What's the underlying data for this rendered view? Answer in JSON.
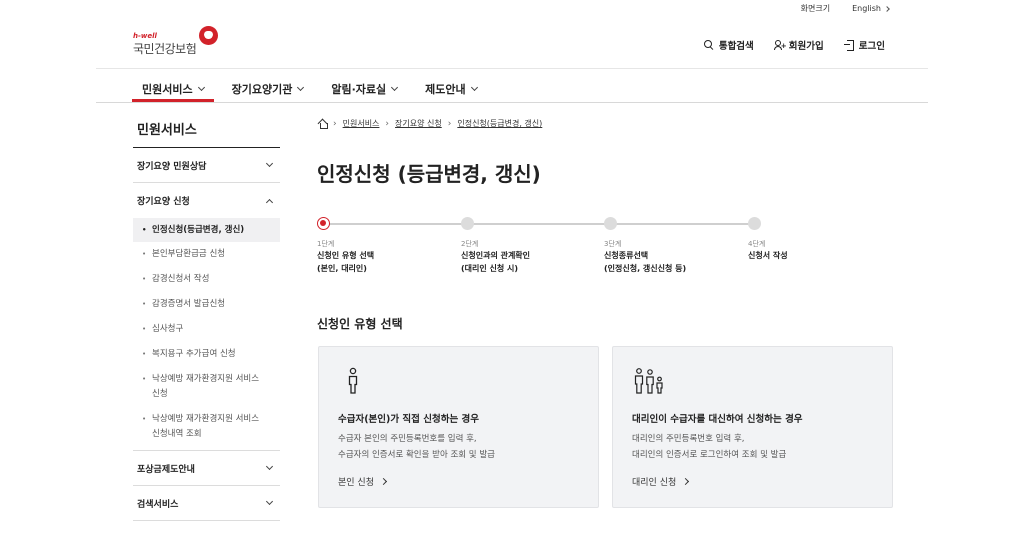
{
  "util": {
    "screen_size": "화면크기",
    "english": "English"
  },
  "logo": {
    "sub": "h-well",
    "name": "국민건강보험"
  },
  "header": {
    "search": "통합검색",
    "join": "회원가입",
    "login": "로그인"
  },
  "gnb": [
    {
      "label": "민원서비스"
    },
    {
      "label": "장기요양기관"
    },
    {
      "label": "알림·자료실"
    },
    {
      "label": "제도안내"
    }
  ],
  "sidebar": {
    "title": "민원서비스",
    "sections": [
      {
        "label": "장기요양 민원상담"
      },
      {
        "label": "장기요양 신청"
      },
      {
        "label": "포상금제도안내"
      },
      {
        "label": "검색서비스"
      }
    ],
    "items": [
      {
        "label": "인정신청(등급변경, 갱신)"
      },
      {
        "label": "본인부담환급금 신청"
      },
      {
        "label": "감경신청서 작성"
      },
      {
        "label": "감경증명서 발급신청"
      },
      {
        "label": "심사청구"
      },
      {
        "label": "복지용구 추가급여 신청"
      },
      {
        "label_1": "낙상예방 재가환경지원 서비스",
        "label_2": "신청"
      },
      {
        "label_1": "낙상예방 재가환경지원 서비스",
        "label_2": "신청내역 조회"
      }
    ]
  },
  "breadcrumb": {
    "home": "홈",
    "b1": "민원서비스",
    "b2": "장기요양 신청",
    "b3": "인정신청(등급변경, 갱신)"
  },
  "page_title": "인정신청 (등급변경, 갱신)",
  "steps": [
    {
      "num": "1단계",
      "line1": "신청인 유형 선택",
      "line2": "(본인, 대리인)"
    },
    {
      "num": "2단계",
      "line1": "신청인과의 관계확인",
      "line2": "(대리인 신청 시)"
    },
    {
      "num": "3단계",
      "line1": "신청종류선택",
      "line2": "(인정신청, 갱신신청 등)"
    },
    {
      "num": "4단계",
      "line1": "신청서 작성",
      "line2": ""
    }
  ],
  "section_title": "신청인 유형 선택",
  "cards": [
    {
      "icon": "person-icon",
      "title": "수급자(본인)가 직접 신청하는 경우",
      "desc1": "수급자 본인의 주민등록번호를 입력 후,",
      "desc2": "수급자의 인증서로 확인을 받아 조회 및 발급",
      "link": "본인 신청"
    },
    {
      "icon": "family-icon",
      "title": "대리인이 수급자를 대신하여 신청하는 경우",
      "desc1": "대리인의 주민등록번호 입력 후,",
      "desc2": "대리인의 인증서로 로그인하여 조회 및 발급",
      "link": "대리인 신청"
    }
  ],
  "colors": {
    "accent": "#d2222a",
    "card_bg": "#f2f3f5"
  }
}
